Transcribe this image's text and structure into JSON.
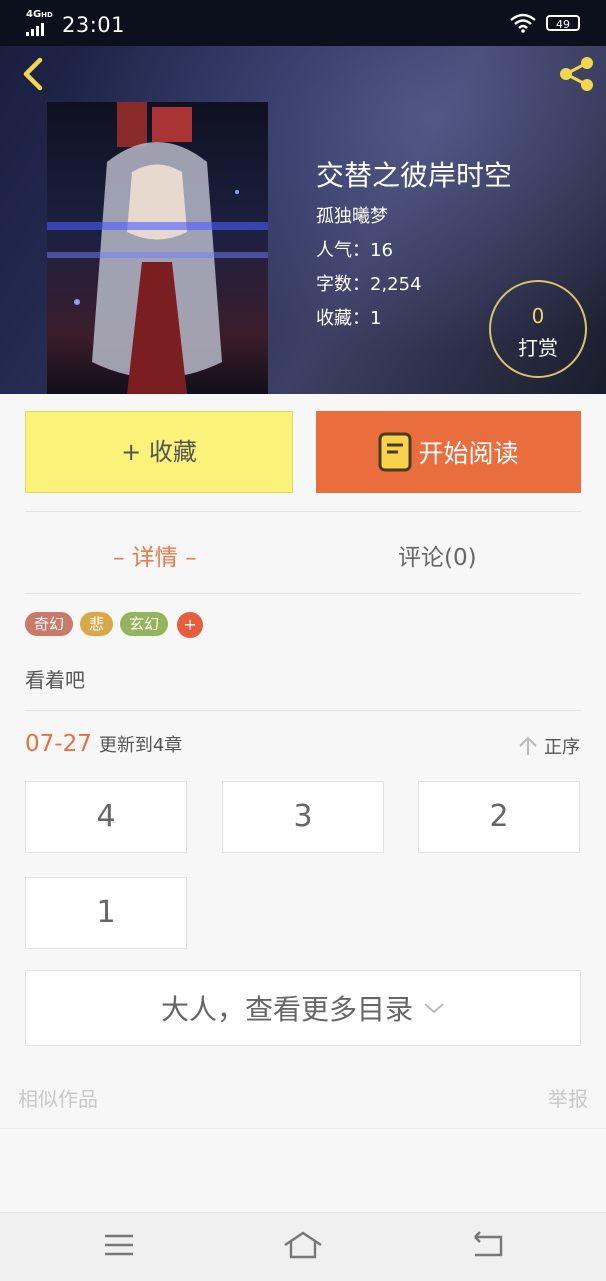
{
  "status_bar": {
    "network": "4G",
    "network_sub": "HD",
    "time": "23:01",
    "battery": "49"
  },
  "book": {
    "title": "交替之彼岸时空",
    "author": "孤独曦梦",
    "popularity": "人气：16",
    "word_count": "字数：2,254",
    "favorites": "收藏：1"
  },
  "tip": {
    "count": "0",
    "label": "打赏"
  },
  "actions": {
    "collect_label": "+ 收藏",
    "read_label": "开始阅读"
  },
  "tabs": {
    "detail": "– 详情 –",
    "comments": "评论(0)"
  },
  "tags": [
    {
      "label": "奇幻",
      "color": "#c97a6a"
    },
    {
      "label": "悲",
      "color": "#d9a84a"
    },
    {
      "label": "玄幻",
      "color": "#93b45c"
    }
  ],
  "tag_add": "+",
  "description": "看着吧",
  "updates": {
    "date": "07-27",
    "text": "更新到4章",
    "order_label": "正序"
  },
  "chapters": [
    "4",
    "3",
    "2",
    "1"
  ],
  "more_catalog": "大人，查看更多目录",
  "footer": {
    "similar": "相似作品",
    "report": "举报"
  },
  "icons": {
    "back": "chevron-left-icon",
    "share": "share-icon",
    "read": "book-icon",
    "order": "arrow-up-icon",
    "more": "chevron-down-icon",
    "nav_menu": "menu-icon",
    "nav_home": "home-icon",
    "nav_back": "back-icon"
  },
  "colors": {
    "accent": "#ea6d3e",
    "collect": "#fbf27a",
    "gold": "#e8d36a"
  }
}
